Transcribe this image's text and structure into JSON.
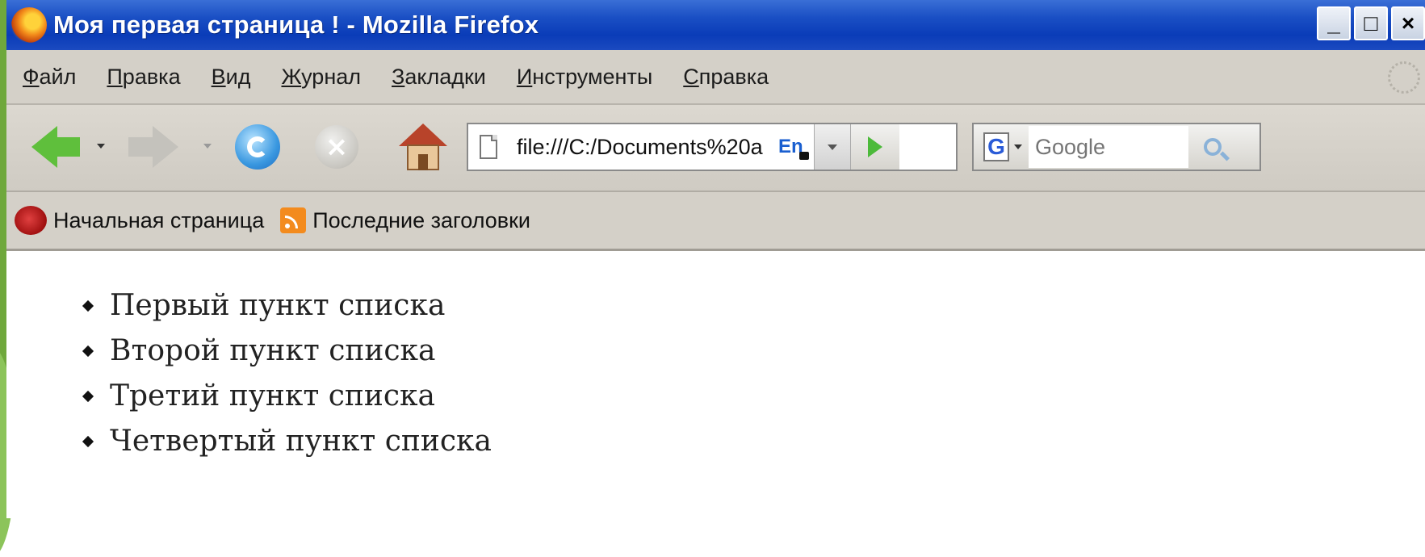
{
  "window": {
    "title": "Моя первая страница ! - Mozilla Firefox",
    "controls": {
      "minimize": "_",
      "maximize": "□",
      "close": "×"
    }
  },
  "menu": {
    "items": [
      {
        "accel": "Ф",
        "rest": "айл"
      },
      {
        "accel": "П",
        "rest": "равка"
      },
      {
        "accel": "В",
        "rest": "ид"
      },
      {
        "accel": "Ж",
        "rest": "урнал"
      },
      {
        "accel": "З",
        "rest": "акладки"
      },
      {
        "accel": "И",
        "rest": "нструменты"
      },
      {
        "accel": "С",
        "rest": "правка"
      }
    ]
  },
  "navbar": {
    "url": "file:///C:/Documents%20a",
    "lang": "En",
    "search": {
      "engine_letter": "G",
      "placeholder": "Google"
    },
    "stop_glyph": "×"
  },
  "bookmarks": {
    "items": [
      {
        "label": "Начальная страница",
        "icon": "firefox-icon"
      },
      {
        "label": "Последние заголовки",
        "icon": "rss-icon"
      }
    ]
  },
  "content": {
    "list": [
      "Первый пункт списка",
      "Второй пункт списка",
      "Третий пункт списка",
      "Четвертый пункт списка"
    ]
  },
  "colors": {
    "titlebar": "#0a3cb8",
    "chrome": "#d4d0c8",
    "go_arrow": "#4cba3a",
    "slide_background": "#6fa83c"
  }
}
